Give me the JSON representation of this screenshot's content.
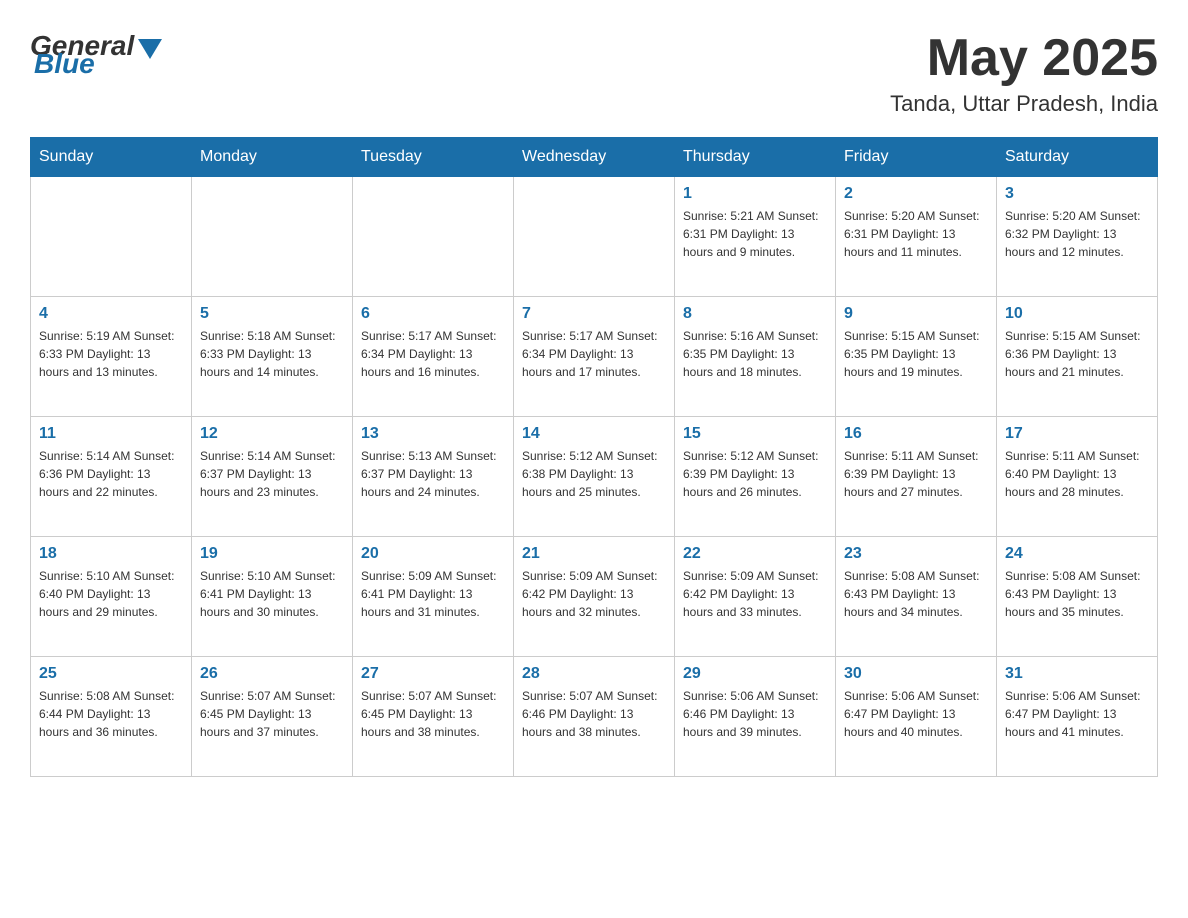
{
  "logo": {
    "general": "General",
    "blue": "Blue"
  },
  "header": {
    "month": "May 2025",
    "location": "Tanda, Uttar Pradesh, India"
  },
  "weekdays": [
    "Sunday",
    "Monday",
    "Tuesday",
    "Wednesday",
    "Thursday",
    "Friday",
    "Saturday"
  ],
  "weeks": [
    [
      {
        "day": "",
        "info": ""
      },
      {
        "day": "",
        "info": ""
      },
      {
        "day": "",
        "info": ""
      },
      {
        "day": "",
        "info": ""
      },
      {
        "day": "1",
        "info": "Sunrise: 5:21 AM\nSunset: 6:31 PM\nDaylight: 13 hours and 9 minutes."
      },
      {
        "day": "2",
        "info": "Sunrise: 5:20 AM\nSunset: 6:31 PM\nDaylight: 13 hours and 11 minutes."
      },
      {
        "day": "3",
        "info": "Sunrise: 5:20 AM\nSunset: 6:32 PM\nDaylight: 13 hours and 12 minutes."
      }
    ],
    [
      {
        "day": "4",
        "info": "Sunrise: 5:19 AM\nSunset: 6:33 PM\nDaylight: 13 hours and 13 minutes."
      },
      {
        "day": "5",
        "info": "Sunrise: 5:18 AM\nSunset: 6:33 PM\nDaylight: 13 hours and 14 minutes."
      },
      {
        "day": "6",
        "info": "Sunrise: 5:17 AM\nSunset: 6:34 PM\nDaylight: 13 hours and 16 minutes."
      },
      {
        "day": "7",
        "info": "Sunrise: 5:17 AM\nSunset: 6:34 PM\nDaylight: 13 hours and 17 minutes."
      },
      {
        "day": "8",
        "info": "Sunrise: 5:16 AM\nSunset: 6:35 PM\nDaylight: 13 hours and 18 minutes."
      },
      {
        "day": "9",
        "info": "Sunrise: 5:15 AM\nSunset: 6:35 PM\nDaylight: 13 hours and 19 minutes."
      },
      {
        "day": "10",
        "info": "Sunrise: 5:15 AM\nSunset: 6:36 PM\nDaylight: 13 hours and 21 minutes."
      }
    ],
    [
      {
        "day": "11",
        "info": "Sunrise: 5:14 AM\nSunset: 6:36 PM\nDaylight: 13 hours and 22 minutes."
      },
      {
        "day": "12",
        "info": "Sunrise: 5:14 AM\nSunset: 6:37 PM\nDaylight: 13 hours and 23 minutes."
      },
      {
        "day": "13",
        "info": "Sunrise: 5:13 AM\nSunset: 6:37 PM\nDaylight: 13 hours and 24 minutes."
      },
      {
        "day": "14",
        "info": "Sunrise: 5:12 AM\nSunset: 6:38 PM\nDaylight: 13 hours and 25 minutes."
      },
      {
        "day": "15",
        "info": "Sunrise: 5:12 AM\nSunset: 6:39 PM\nDaylight: 13 hours and 26 minutes."
      },
      {
        "day": "16",
        "info": "Sunrise: 5:11 AM\nSunset: 6:39 PM\nDaylight: 13 hours and 27 minutes."
      },
      {
        "day": "17",
        "info": "Sunrise: 5:11 AM\nSunset: 6:40 PM\nDaylight: 13 hours and 28 minutes."
      }
    ],
    [
      {
        "day": "18",
        "info": "Sunrise: 5:10 AM\nSunset: 6:40 PM\nDaylight: 13 hours and 29 minutes."
      },
      {
        "day": "19",
        "info": "Sunrise: 5:10 AM\nSunset: 6:41 PM\nDaylight: 13 hours and 30 minutes."
      },
      {
        "day": "20",
        "info": "Sunrise: 5:09 AM\nSunset: 6:41 PM\nDaylight: 13 hours and 31 minutes."
      },
      {
        "day": "21",
        "info": "Sunrise: 5:09 AM\nSunset: 6:42 PM\nDaylight: 13 hours and 32 minutes."
      },
      {
        "day": "22",
        "info": "Sunrise: 5:09 AM\nSunset: 6:42 PM\nDaylight: 13 hours and 33 minutes."
      },
      {
        "day": "23",
        "info": "Sunrise: 5:08 AM\nSunset: 6:43 PM\nDaylight: 13 hours and 34 minutes."
      },
      {
        "day": "24",
        "info": "Sunrise: 5:08 AM\nSunset: 6:43 PM\nDaylight: 13 hours and 35 minutes."
      }
    ],
    [
      {
        "day": "25",
        "info": "Sunrise: 5:08 AM\nSunset: 6:44 PM\nDaylight: 13 hours and 36 minutes."
      },
      {
        "day": "26",
        "info": "Sunrise: 5:07 AM\nSunset: 6:45 PM\nDaylight: 13 hours and 37 minutes."
      },
      {
        "day": "27",
        "info": "Sunrise: 5:07 AM\nSunset: 6:45 PM\nDaylight: 13 hours and 38 minutes."
      },
      {
        "day": "28",
        "info": "Sunrise: 5:07 AM\nSunset: 6:46 PM\nDaylight: 13 hours and 38 minutes."
      },
      {
        "day": "29",
        "info": "Sunrise: 5:06 AM\nSunset: 6:46 PM\nDaylight: 13 hours and 39 minutes."
      },
      {
        "day": "30",
        "info": "Sunrise: 5:06 AM\nSunset: 6:47 PM\nDaylight: 13 hours and 40 minutes."
      },
      {
        "day": "31",
        "info": "Sunrise: 5:06 AM\nSunset: 6:47 PM\nDaylight: 13 hours and 41 minutes."
      }
    ]
  ]
}
